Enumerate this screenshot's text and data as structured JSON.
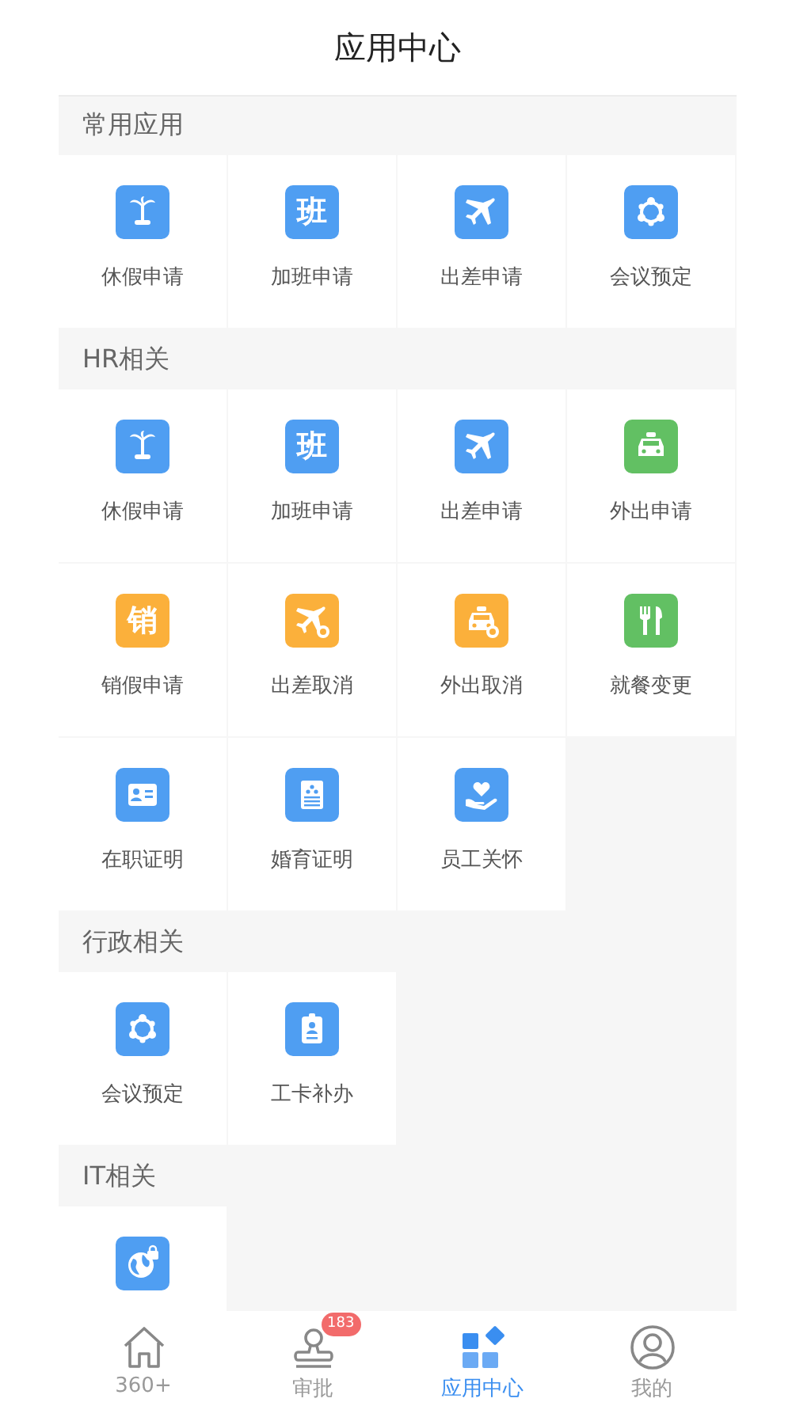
{
  "header": {
    "title": "应用中心"
  },
  "sections": [
    {
      "title": "常用应用",
      "items": [
        {
          "label": "休假申请",
          "kind": "palm",
          "color": "#4f9ef2"
        },
        {
          "label": "加班申请",
          "kind": "glyph",
          "glyph": "班",
          "color": "#4f9ef2"
        },
        {
          "label": "出差申请",
          "kind": "plane",
          "color": "#4f9ef2"
        },
        {
          "label": "会议预定",
          "kind": "meeting",
          "color": "#4f9ef2"
        }
      ]
    },
    {
      "title": "HR相关",
      "items": [
        {
          "label": "休假申请",
          "kind": "palm",
          "color": "#4f9ef2"
        },
        {
          "label": "加班申请",
          "kind": "glyph",
          "glyph": "班",
          "color": "#4f9ef2"
        },
        {
          "label": "出差申请",
          "kind": "plane",
          "color": "#4f9ef2"
        },
        {
          "label": "外出申请",
          "kind": "taxi",
          "color": "#62c063"
        },
        {
          "label": "销假申请",
          "kind": "glyph",
          "glyph": "销",
          "color": "#fbb03b"
        },
        {
          "label": "出差取消",
          "kind": "plane-cancel",
          "color": "#fbb03b"
        },
        {
          "label": "外出取消",
          "kind": "taxi-cancel",
          "color": "#fbb03b"
        },
        {
          "label": "就餐变更",
          "kind": "utensils",
          "color": "#62c063"
        },
        {
          "label": "在职证明",
          "kind": "idcard",
          "color": "#4f9ef2"
        },
        {
          "label": "婚育证明",
          "kind": "certificate",
          "color": "#4f9ef2"
        },
        {
          "label": "员工关怀",
          "kind": "heart-hand",
          "color": "#4f9ef2"
        }
      ]
    },
    {
      "title": "行政相关",
      "items": [
        {
          "label": "会议预定",
          "kind": "meeting",
          "color": "#4f9ef2"
        },
        {
          "label": "工卡补办",
          "kind": "badge",
          "color": "#4f9ef2"
        }
      ]
    },
    {
      "title": "IT相关",
      "items": [
        {
          "kind": "globe-lock",
          "color": "#4f9ef2"
        }
      ]
    }
  ],
  "tabbar": [
    {
      "label": "360+",
      "kind": "home",
      "selected": false
    },
    {
      "label": "审批",
      "kind": "stamp",
      "badge": "183",
      "selected": false
    },
    {
      "label": "应用中心",
      "kind": "apps",
      "selected": true
    },
    {
      "label": "我的",
      "kind": "user",
      "selected": false
    }
  ]
}
